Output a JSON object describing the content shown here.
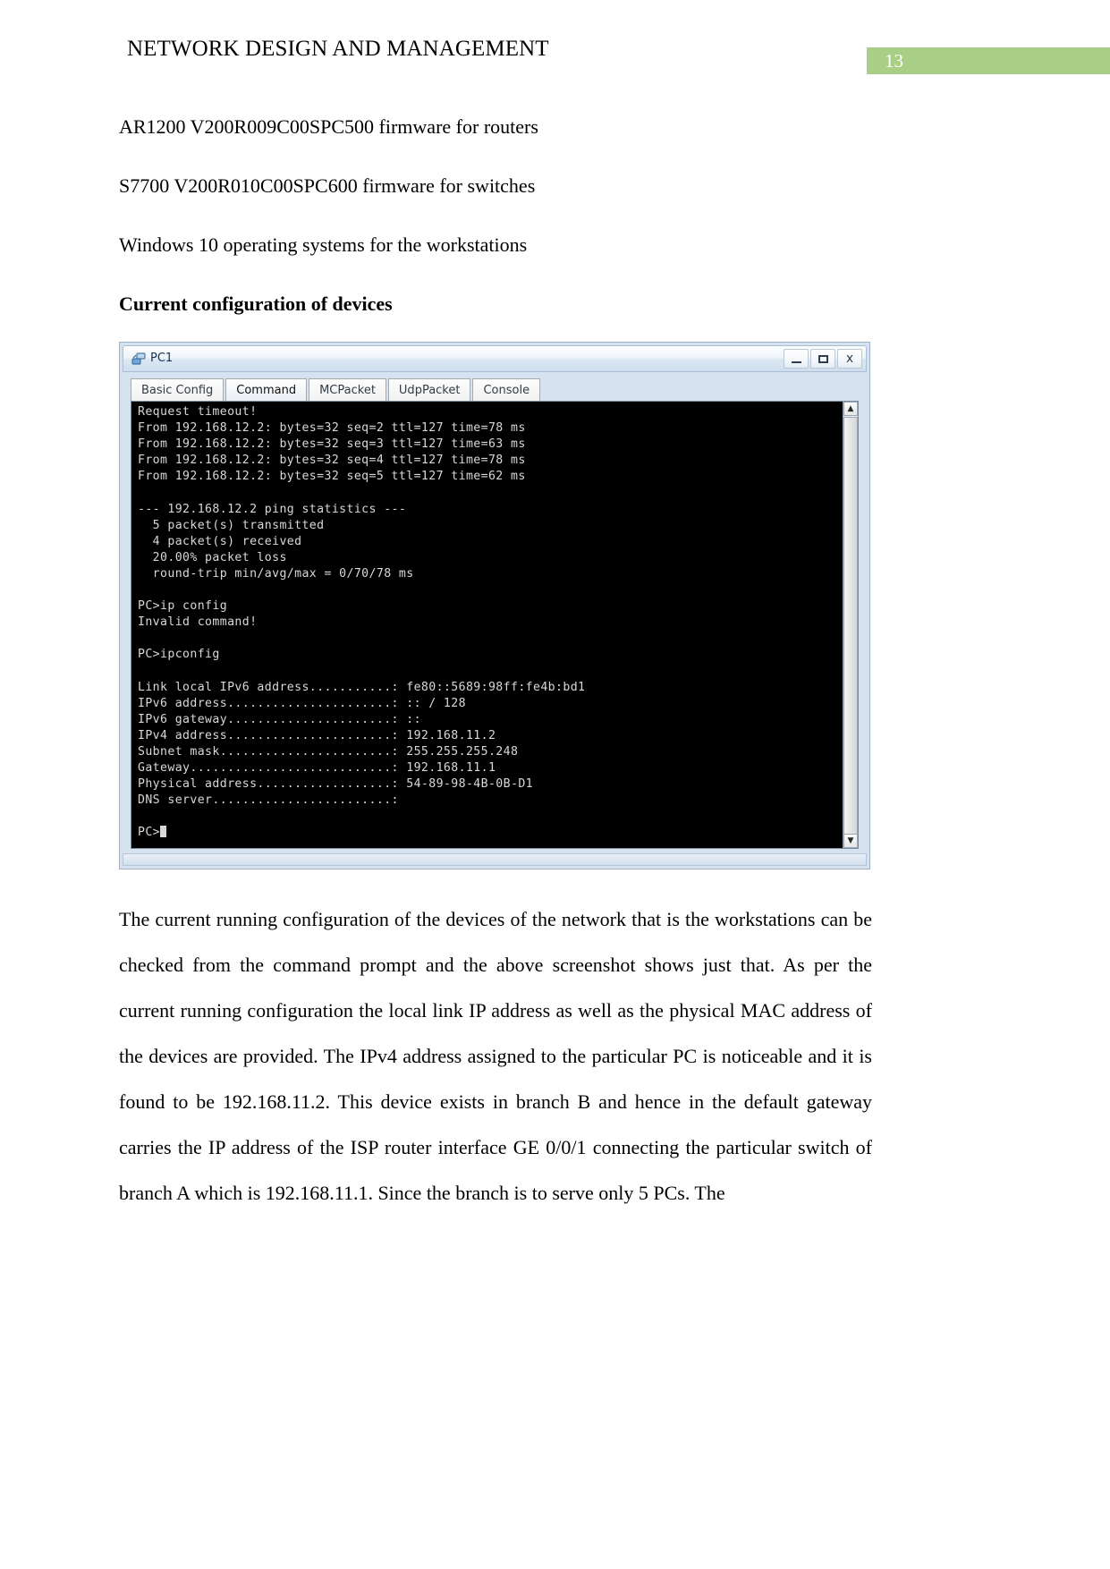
{
  "header": {
    "document_title": "NETWORK DESIGN AND MANAGEMENT",
    "page_number": "13",
    "badge_color": "#a9cf86"
  },
  "body": {
    "lines": [
      "AR1200 V200R009C00SPC500 firmware for routers",
      "S7700 V200R010C00SPC600 firmware for switches",
      "Windows 10 operating systems for the workstations"
    ],
    "section_heading": "Current configuration of devices",
    "closing_paragraph": "The current running configuration of the devices of the network that is the workstations can be checked from the command prompt and the above screenshot shows just that. As per the current running configuration the local link IP address as well as the physical MAC address of the devices are provided. The IPv4 address assigned to the particular PC is noticeable and it is found to be 192.168.11.2. This device exists in branch B and hence in the default gateway carries the IP address of the ISP router interface GE 0/0/1 connecting the particular switch of branch A which is 192.168.11.1. Since the branch is to serve only 5 PCs. The"
  },
  "screenshot": {
    "window_title": "PC1",
    "window_icon": "pc-network-icon",
    "buttons": {
      "minimize": "minimize-icon",
      "maximize": "maximize-icon",
      "close": "x"
    },
    "tabs": [
      {
        "label": "Basic Config",
        "active": false
      },
      {
        "label": "Command",
        "active": true
      },
      {
        "label": "MCPacket",
        "active": false
      },
      {
        "label": "UdpPacket",
        "active": false
      },
      {
        "label": "Console",
        "active": false
      }
    ],
    "scrollbar": {
      "up_arrow": "▲",
      "down_arrow": "▼"
    },
    "console_output": "Request timeout!\nFrom 192.168.12.2: bytes=32 seq=2 ttl=127 time=78 ms\nFrom 192.168.12.2: bytes=32 seq=3 ttl=127 time=63 ms\nFrom 192.168.12.2: bytes=32 seq=4 ttl=127 time=78 ms\nFrom 192.168.12.2: bytes=32 seq=5 ttl=127 time=62 ms\n\n--- 192.168.12.2 ping statistics ---\n  5 packet(s) transmitted\n  4 packet(s) received\n  20.00% packet loss\n  round-trip min/avg/max = 0/70/78 ms\n\nPC>ip config\nInvalid command!\n\nPC>ipconfig\n\nLink local IPv6 address...........: fe80::5689:98ff:fe4b:bd1\nIPv6 address......................: :: / 128\nIPv6 gateway......................: ::\nIPv4 address......................: 192.168.11.2\nSubnet mask.......................: 255.255.255.248\nGateway...........................: 192.168.11.1\nPhysical address..................: 54-89-98-4B-0B-D1\nDNS server........................:\n\nPC>"
  }
}
